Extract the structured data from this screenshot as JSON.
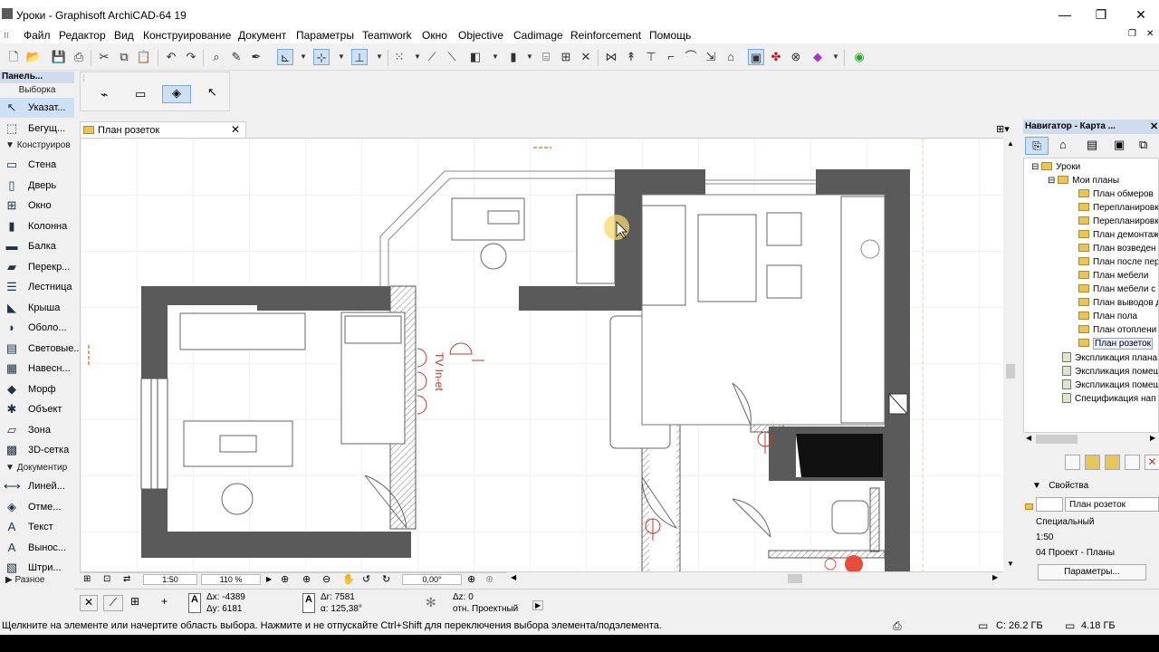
{
  "window": {
    "title": "Уроки - Graphisoft ArchiCAD-64 19",
    "minimize": "—",
    "maximize": "❐",
    "close": "✕"
  },
  "menu": [
    "Файл",
    "Редактор",
    "Вид",
    "Конструирование",
    "Документ",
    "Параметры",
    "Teamwork",
    "Окно",
    "Objective",
    "Cadimage",
    "Reinforcement",
    "Помощь"
  ],
  "toolbox": {
    "header": "Панель...",
    "section_select": "Выборка",
    "pointer": "Указат...",
    "marquee": "Бегущ...",
    "section_design": "Конструиров",
    "design_items": [
      "Стена",
      "Дверь",
      "Окно",
      "Колонна",
      "Балка",
      "Перекр...",
      "Лестница",
      "Крыша",
      "Оболо...",
      "Световые...",
      "Навесн...",
      "Морф",
      "Объект",
      "Зона",
      "3D-сетка"
    ],
    "section_document": "Документир",
    "document_items": [
      "Линей...",
      "Отме...",
      "Текст",
      "Вынос...",
      "Штри..."
    ],
    "section_more": "Разное"
  },
  "tab": {
    "label": "План розеток",
    "close": "✕"
  },
  "drawing": {
    "annotation": "TV In-et"
  },
  "zoombar": {
    "scale": "1:50",
    "zoom": "110 %",
    "angle": "0,00°"
  },
  "navigator": {
    "header": "Навигатор - Карта ...",
    "root": "Уроки",
    "folder": "Мои планы",
    "plans": [
      "План обмеров",
      "Перепланировк",
      "Перепланировк",
      "План демонтаж",
      "План возведен",
      "План после пер",
      "План мебели",
      "План мебели с з",
      "План выводов д",
      "План пола",
      "План отоплени",
      "План розеток"
    ],
    "sheets": [
      "Экспликация плана",
      "Экспликация помещ",
      "Экспликация помещ",
      "Спецификация нап"
    ],
    "selected": "План розеток"
  },
  "properties": {
    "title": "Свойства",
    "name": "План розеток",
    "special": "Специальный",
    "scale": "1:50",
    "project": "04 Проект - Планы",
    "button": "Параметры..."
  },
  "coords": {
    "dx": "Δx: -4389",
    "dy": "Δy: 6181",
    "dr": "Δr: 7581",
    "angle": "α: 125,38°",
    "dz": "Δz: 0",
    "ref": "отн. Проектный"
  },
  "status": {
    "message": "Щелкните на элементе или начертите область выбора. Нажмите и не отпускайте Ctrl+Shift для переключения выбора элемента/подэлемента.",
    "disk": "C: 26.2 ГБ",
    "memory": "4.18 ГБ"
  }
}
